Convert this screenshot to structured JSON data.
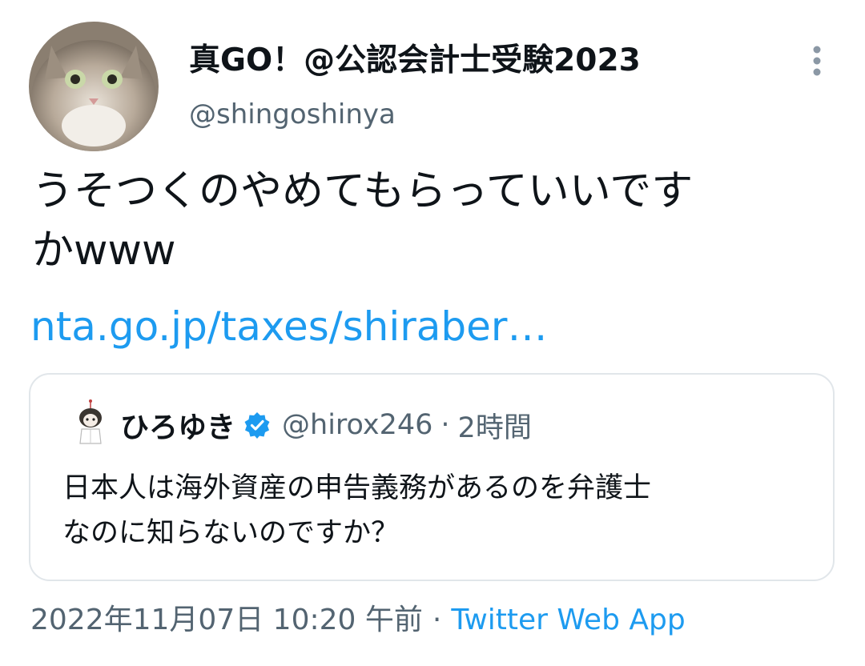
{
  "author": {
    "display_name": "真GO！@公認会計士受験2023",
    "handle": "@shingoshinya"
  },
  "tweet": {
    "text_line1": "うそつくのやめてもらっていいです",
    "text_line2": "かwww",
    "link_text": "nta.go.jp/taxes/shiraber…"
  },
  "quoted_tweet": {
    "display_name": "ひろゆき",
    "handle": "@hirox246",
    "separator": "·",
    "time": "2時間",
    "text_line1": "日本人は海外資産の申告義務があるのを弁護士",
    "text_line2": "なのに知らないのですか？"
  },
  "meta": {
    "timestamp": "2022年11月07日 10:20 午前",
    "separator": "·",
    "source": "Twitter Web App"
  },
  "icons": {
    "more": "more-vertical-icon",
    "verified": "verified-badge-icon"
  },
  "colors": {
    "link": "#1d9bf0",
    "secondary_text": "#536471",
    "primary_text": "#0f1419",
    "card_border": "#e1e6ea"
  }
}
